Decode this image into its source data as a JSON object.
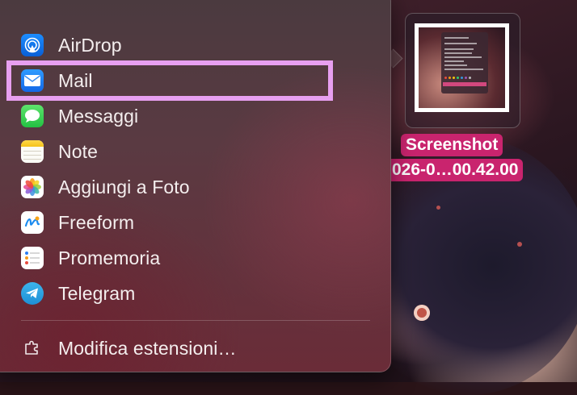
{
  "share_menu": {
    "items": [
      {
        "label": "AirDrop",
        "icon": "airdrop-icon"
      },
      {
        "label": "Mail",
        "icon": "mail-icon"
      },
      {
        "label": "Messaggi",
        "icon": "messages-icon"
      },
      {
        "label": "Note",
        "icon": "notes-icon"
      },
      {
        "label": "Aggiungi a Foto",
        "icon": "photos-icon"
      },
      {
        "label": "Freeform",
        "icon": "freeform-icon"
      },
      {
        "label": "Promemoria",
        "icon": "reminders-icon"
      },
      {
        "label": "Telegram",
        "icon": "telegram-icon"
      }
    ],
    "edit_extensions": {
      "label": "Modifica estensioni…",
      "icon": "extensions-icon"
    },
    "highlighted_item": "Mail"
  },
  "desktop_file": {
    "name_line1": "Screenshot",
    "name_line2": "026-0…00.42.00"
  },
  "colors": {
    "highlight_border": "#e79ff0",
    "file_label_bg": "#c9246e"
  }
}
